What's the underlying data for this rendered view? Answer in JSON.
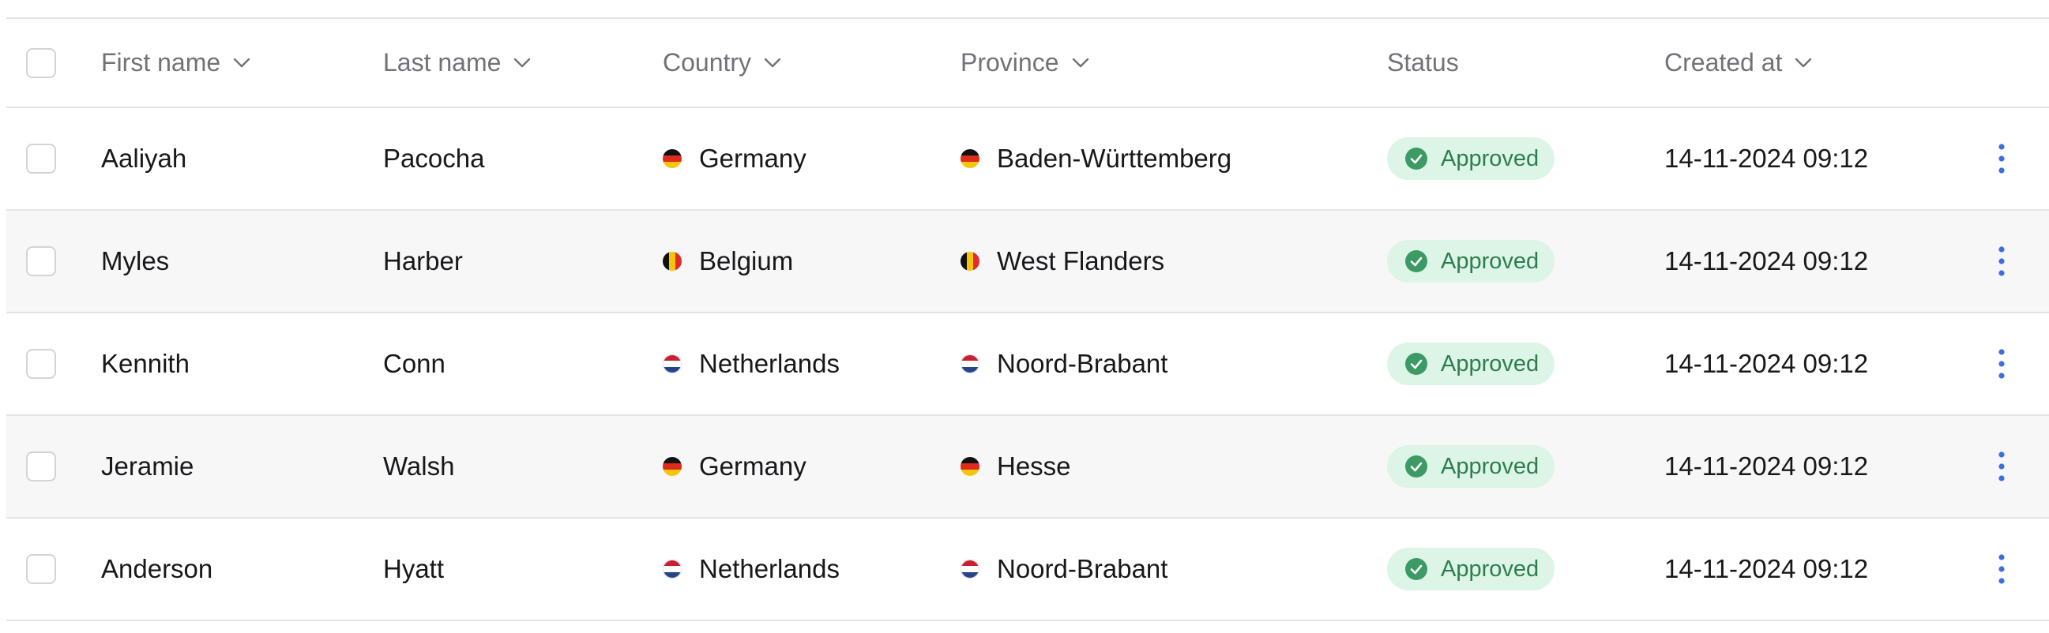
{
  "table": {
    "headers": {
      "first_name": "First name",
      "last_name": "Last name",
      "country": "Country",
      "province": "Province",
      "status": "Status",
      "created_at": "Created at"
    },
    "rows": [
      {
        "first_name": "Aaliyah",
        "last_name": "Pacocha",
        "country": "Germany",
        "country_flag": "de",
        "province": "Baden-Württemberg",
        "province_flag": "de",
        "status": "Approved",
        "created_at": "14-11-2024 09:12"
      },
      {
        "first_name": "Myles",
        "last_name": "Harber",
        "country": "Belgium",
        "country_flag": "be",
        "province": "West Flanders",
        "province_flag": "be",
        "status": "Approved",
        "created_at": "14-11-2024 09:12"
      },
      {
        "first_name": "Kennith",
        "last_name": "Conn",
        "country": "Netherlands",
        "country_flag": "nl",
        "province": "Noord-Brabant",
        "province_flag": "nl",
        "status": "Approved",
        "created_at": "14-11-2024 09:12"
      },
      {
        "first_name": "Jeramie",
        "last_name": "Walsh",
        "country": "Germany",
        "country_flag": "de",
        "province": "Hesse",
        "province_flag": "de",
        "status": "Approved",
        "created_at": "14-11-2024 09:12"
      },
      {
        "first_name": "Anderson",
        "last_name": "Hyatt",
        "country": "Netherlands",
        "country_flag": "nl",
        "province": "Noord-Brabant",
        "province_flag": "nl",
        "status": "Approved",
        "created_at": "14-11-2024 09:12"
      }
    ]
  },
  "colors": {
    "status_approved_bg": "#dcf5e7",
    "status_approved_text": "#2e7d4f",
    "action_icon": "#3b6fe0"
  },
  "icons": {
    "sort": "chevron-down-icon",
    "status": "check-circle-icon",
    "row_actions": "more-vertical-icon"
  }
}
